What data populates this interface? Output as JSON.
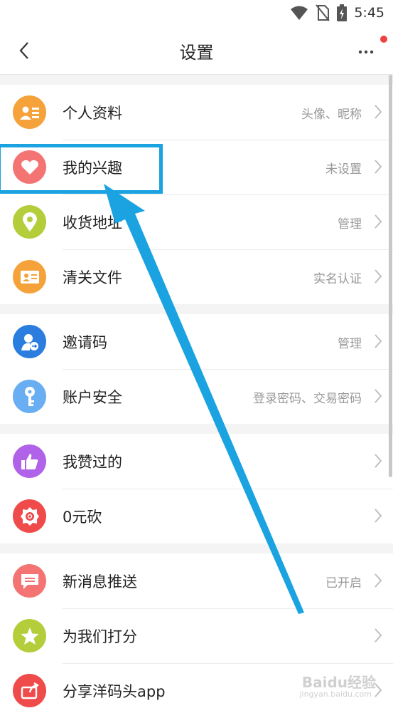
{
  "status_bar": {
    "time": "5:45"
  },
  "header": {
    "title": "设置"
  },
  "groups": [
    {
      "items": [
        {
          "label": "个人资料",
          "value": "头像、昵称",
          "icon": "id-card-icon",
          "color": "#f6a23a"
        },
        {
          "label": "我的兴趣",
          "value": "未设置",
          "icon": "heart-icon",
          "color": "#f47474"
        },
        {
          "label": "收货地址",
          "value": "管理",
          "icon": "location-pin-icon",
          "color": "#b3cd3b"
        },
        {
          "label": "清关文件",
          "value": "实名认证",
          "icon": "document-card-icon",
          "color": "#f6a23a"
        }
      ]
    },
    {
      "items": [
        {
          "label": "邀请码",
          "value": "管理",
          "icon": "invite-user-icon",
          "color": "#2b7de0"
        },
        {
          "label": "账户安全",
          "value": "登录密码、交易密码",
          "icon": "key-icon",
          "color": "#69aef2"
        }
      ]
    },
    {
      "items": [
        {
          "label": "我赞过的",
          "value": "",
          "icon": "thumbs-up-icon",
          "color": "#b063e8"
        },
        {
          "label": "0元砍",
          "value": "",
          "icon": "discount-badge-icon",
          "color": "#ef4b4b"
        }
      ]
    },
    {
      "items": [
        {
          "label": "新消息推送",
          "value": "已开启",
          "icon": "message-icon",
          "color": "#f47474"
        },
        {
          "label": "为我们打分",
          "value": "",
          "icon": "star-icon",
          "color": "#b3cd3b"
        },
        {
          "label": "分享洋码头app",
          "value": "",
          "icon": "share-icon",
          "color": "#ef4b4b"
        }
      ]
    }
  ],
  "annotation": {
    "color": "#1aa3e0"
  },
  "watermark": {
    "text": "Baidu经验",
    "sub": "jingyan.baidu.com"
  }
}
